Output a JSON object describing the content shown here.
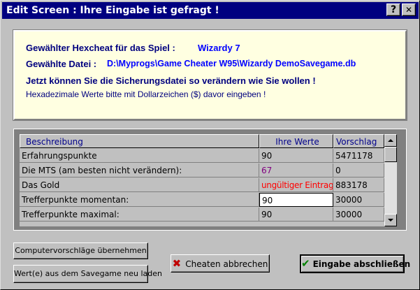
{
  "window": {
    "title": "Edit Screen : Ihre Eingabe ist gefragt !",
    "help_label": "?",
    "close_label": "✕"
  },
  "info": {
    "game_label": "Gewählter Hexcheat für das Spiel :",
    "game_value": "Wizardy 7",
    "file_label": "Gewählte Datei :",
    "file_value": "D:\\Myprogs\\Game Cheater W95\\Wizardy DemoSavegame.db",
    "line3": "Jetzt können Sie die Sicherungsdatei so verändern wie Sie wollen !",
    "line4": "Hexadezimale Werte bitte mit Dollarzeichen ($) davor eingeben !"
  },
  "grid": {
    "headers": {
      "description": "Beschreibung",
      "values": "Ihre Werte",
      "suggestion": "Vorschlag"
    },
    "rows": [
      {
        "description": "Erfahrungspunkte",
        "value": "90",
        "suggestion": "5471178"
      },
      {
        "description": "Die MTS (am besten nicht verändern):",
        "value": "67",
        "suggestion": "0"
      },
      {
        "description": "Das Gold",
        "value": "ungültiger Eintrag",
        "suggestion": "883178"
      },
      {
        "description": "Trefferpunkte momentan:",
        "value": "90",
        "suggestion": "30000"
      },
      {
        "description": "Trefferpunkte maximal:",
        "value": "90",
        "suggestion": "30000"
      }
    ],
    "colors": {
      "mts_value": "#800080",
      "invalid_value": "#ff0000"
    }
  },
  "buttons": {
    "accept_suggestions": "Computervorschläge übernehmen",
    "reload": "Wert(e) aus dem Savegame neu laden",
    "cancel": "Cheaten abbrechen",
    "finish": "Eingabe abschließen"
  },
  "colors": {
    "title_bar": "#000080",
    "info_bg": "#ffffe1",
    "dialog_bg": "#c0c0c0"
  }
}
